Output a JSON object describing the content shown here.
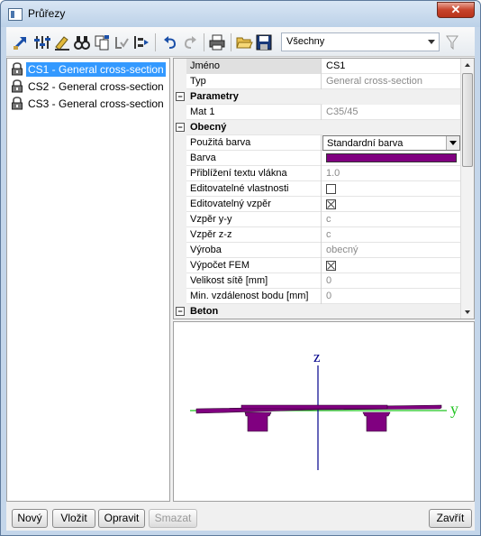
{
  "window": {
    "title": "Průřezy",
    "close_label": "✕"
  },
  "toolbar": {
    "filter_value": "Všechny",
    "buttons": [
      "add-item-icon",
      "properties-icon",
      "edit-icon",
      "binoculars-icon",
      "copy-icon",
      "check-icon",
      "group-icon",
      "undo-icon",
      "redo-icon",
      "print-icon",
      "open-folder-icon",
      "save-icon"
    ]
  },
  "list": {
    "items": [
      {
        "label": "CS1 - General cross-section",
        "selected": true
      },
      {
        "label": "CS2 - General cross-section",
        "selected": false
      },
      {
        "label": "CS3 - General cross-section",
        "selected": false
      }
    ]
  },
  "properties": {
    "rows": [
      {
        "name": "Jméno",
        "value": "CS1"
      },
      {
        "name": "Typ",
        "value": "General cross-section"
      },
      {
        "name": "Parametry",
        "toggle": "−"
      },
      {
        "name": "Mat 1",
        "value": "C35/45"
      },
      {
        "name": "Obecný",
        "toggle": "−"
      },
      {
        "name": "Použitá barva",
        "value": "Standardní barva"
      },
      {
        "name": "Barva",
        "color": "#800080"
      },
      {
        "name": "Přiblížení textu vlákna",
        "value": "1.0"
      },
      {
        "name": "Editovatelné vlastnosti",
        "checked": false
      },
      {
        "name": "Editovatelný vzpěr",
        "checked": true
      },
      {
        "name": "Vzpěr y-y",
        "value": "c"
      },
      {
        "name": "Vzpěr z-z",
        "value": "c"
      },
      {
        "name": "Výroba",
        "value": "obecný"
      },
      {
        "name": "Výpočet FEM",
        "checked": true
      },
      {
        "name": "Velikost sítě [mm]",
        "value": "0"
      },
      {
        "name": "Min. vzdálenost bodu [mm]",
        "value": "0"
      },
      {
        "name": "Beton",
        "toggle": "−"
      }
    ]
  },
  "preview": {
    "axis_z_label": "z",
    "axis_y_label": "y",
    "axis_z_color": "#00008b",
    "axis_y_color": "#22c422",
    "section_color": "#800080"
  },
  "buttons": {
    "new": "Nový",
    "insert": "Vložit",
    "edit": "Opravit",
    "delete": "Smazat",
    "close": "Zavřít"
  }
}
